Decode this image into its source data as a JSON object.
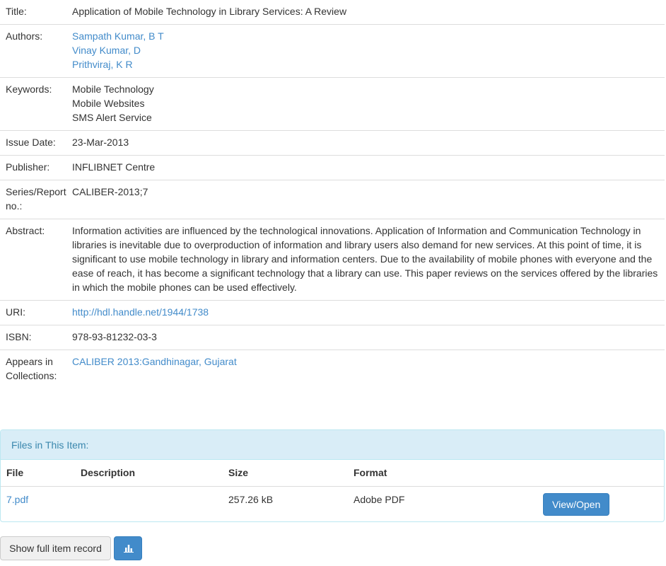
{
  "metadata": {
    "title": {
      "label": "Title:",
      "value": "Application of Mobile Technology in Library Services: A Review"
    },
    "authors": {
      "label": "Authors:",
      "items": [
        "Sampath Kumar, B T",
        "Vinay Kumar, D",
        "Prithviraj, K R"
      ]
    },
    "keywords": {
      "label": "Keywords:",
      "items": [
        "Mobile Technology",
        "Mobile Websites",
        "SMS Alert Service"
      ]
    },
    "issue_date": {
      "label": "Issue Date:",
      "value": "23-Mar-2013"
    },
    "publisher": {
      "label": "Publisher:",
      "value": "INFLIBNET Centre"
    },
    "series": {
      "label": "Series/Report no.:",
      "value": "CALIBER-2013;7"
    },
    "abstract": {
      "label": "Abstract:",
      "value": "Information activities are influenced by the technological innovations. Application of Information and Communication Technology in libraries is inevitable due to overproduction of information and library users also demand for new services. At this point of time, it is significant to use mobile technology in library and information centers. Due to the availability of mobile phones with everyone and the ease of reach, it has become a significant technology that a library can use. This paper reviews on the services offered by the libraries in which the mobile phones can be used effectively."
    },
    "uri": {
      "label": "URI:",
      "value": "http://hdl.handle.net/1944/1738"
    },
    "isbn": {
      "label": "ISBN:",
      "value": "978-93-81232-03-3"
    },
    "collections": {
      "label": "Appears in Collections:",
      "value": "CALIBER 2013:Gandhinagar, Gujarat"
    }
  },
  "files_panel": {
    "heading": "Files in This Item:",
    "columns": [
      "File",
      "Description",
      "Size",
      "Format"
    ],
    "rows": [
      {
        "file": "7.pdf",
        "description": "",
        "size": "257.26 kB",
        "format": "Adobe PDF",
        "action": "View/Open"
      }
    ]
  },
  "actions": {
    "show_full_record": "Show full item record",
    "stats_icon": "bar-chart-icon"
  },
  "colors": {
    "link": "#428bca",
    "panel_heading_bg": "#d9edf7",
    "panel_heading_text": "#3a87ad",
    "primary_button": "#428bca"
  }
}
